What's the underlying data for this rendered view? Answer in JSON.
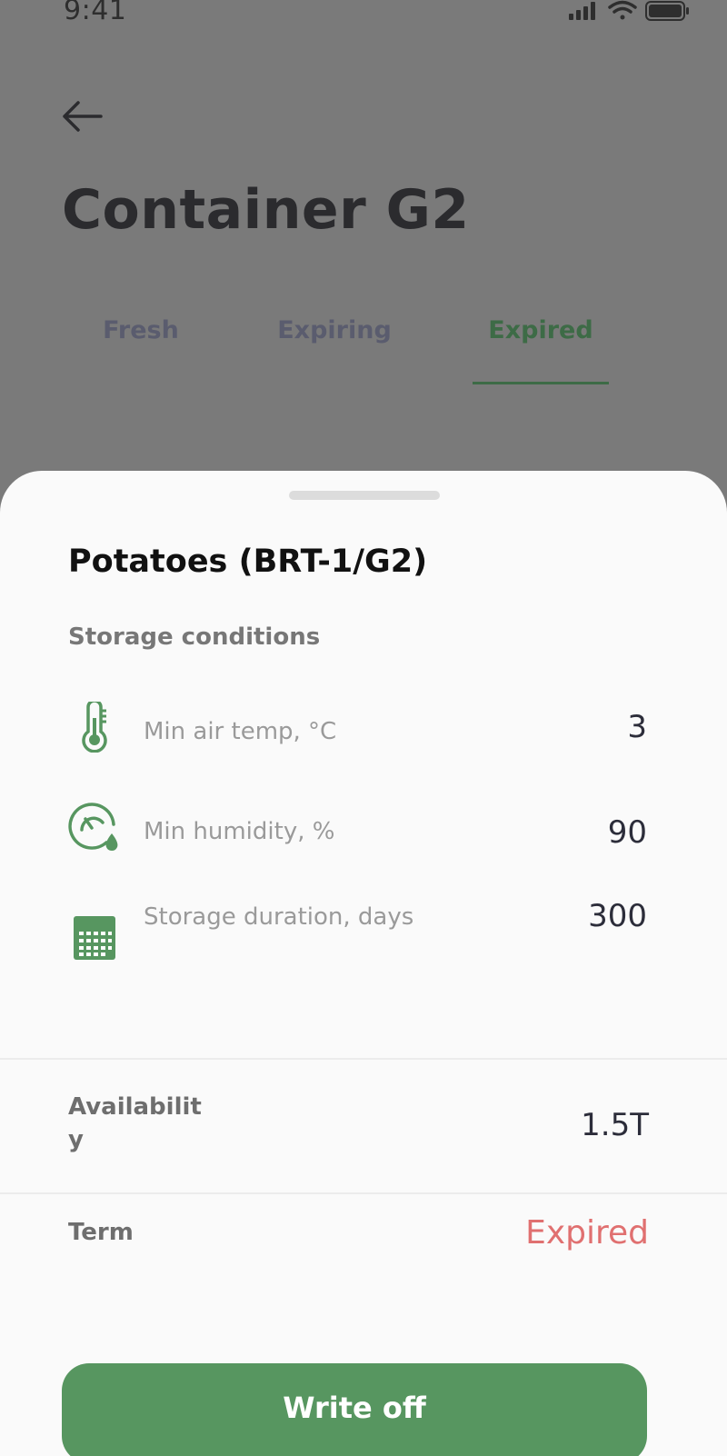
{
  "status_bar": {
    "time": "9:41",
    "icons": [
      "signal-icon",
      "wifi-icon",
      "battery-icon"
    ]
  },
  "header": {
    "back_icon": "arrow-left-icon",
    "title": "Container G2"
  },
  "tabs": [
    {
      "label": "Fresh",
      "active": false
    },
    {
      "label": "Expiring",
      "active": false
    },
    {
      "label": "Expired",
      "active": true
    }
  ],
  "sheet": {
    "product_title": "Potatoes (BRT-1/G2)",
    "storage_section_label": "Storage conditions",
    "conditions": [
      {
        "icon": "thermometer-icon",
        "label": "Min air temp, °C",
        "value": "3"
      },
      {
        "icon": "humidity-gauge-icon",
        "label": "Min humidity, %",
        "value": "90"
      },
      {
        "icon": "calendar-icon",
        "label": "Storage duration, days",
        "value": "300"
      }
    ],
    "availability": {
      "label": "Availability",
      "value": "1.5T"
    },
    "term": {
      "label": "Term",
      "value": "Expired"
    },
    "write_off_label": "Write off"
  },
  "colors": {
    "accent_green": "#579660",
    "tab_active": "#3d6b46",
    "expired_red": "#e07070",
    "overlay_gray": "#7a7a7a"
  }
}
